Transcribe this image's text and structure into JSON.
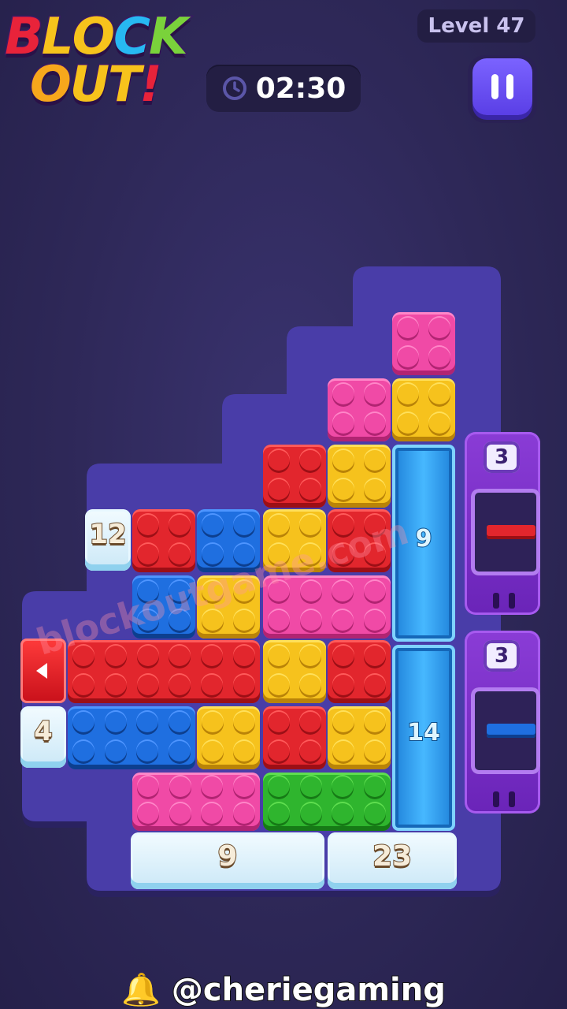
{
  "header": {
    "logo_line1": [
      "B",
      "L",
      "O",
      "C",
      "K"
    ],
    "logo_line2": [
      "O",
      "U",
      "T",
      "!"
    ],
    "logo_colors_line1": [
      "#e8233a",
      "#f7c31c",
      "#f7c31c",
      "#27b8f2",
      "#7ad23b"
    ],
    "logo_colors_line2": [
      "#f7a71c",
      "#f7c31c",
      "#f7c31c",
      "#e8233a"
    ],
    "timer": "02:30",
    "level": "Level 47",
    "icons": {
      "timer": "clock-icon",
      "pause": "pause-icon"
    }
  },
  "colors": {
    "red": "#e2262d",
    "blue": "#1f6fe0",
    "yellow": "#f6c21d",
    "pink": "#f04aa6",
    "green": "#2fb52e",
    "board": "#4a3da8"
  },
  "board": {
    "ice_left_upper": "12",
    "ice_left_lower": "4",
    "ice_bottom_left": "9",
    "ice_bottom_right": "23",
    "pillar_upper": "9",
    "pillar_lower": "14",
    "red_door_icon": "arrow-left-icon",
    "bricks": [
      {
        "color": "pink"
      },
      {
        "color": "pink"
      },
      {
        "color": "yellow"
      },
      {
        "color": "red"
      },
      {
        "color": "yellow"
      },
      {
        "color": "red"
      },
      {
        "color": "blue"
      },
      {
        "color": "yellow"
      },
      {
        "color": "red"
      },
      {
        "color": "blue"
      },
      {
        "color": "yellow"
      },
      {
        "color": "pink"
      },
      {
        "color": "red"
      },
      {
        "color": "yellow"
      },
      {
        "color": "red"
      },
      {
        "color": "blue"
      },
      {
        "color": "yellow"
      },
      {
        "color": "red"
      },
      {
        "color": "yellow"
      },
      {
        "color": "pink"
      },
      {
        "color": "green"
      }
    ]
  },
  "machines": [
    {
      "count": "3",
      "brick_color": "red"
    },
    {
      "count": "3",
      "brick_color": "blue"
    }
  ],
  "watermark": "blockoutgame.com",
  "credit": "@cheriegaming",
  "credit_icon": "bell-icon"
}
